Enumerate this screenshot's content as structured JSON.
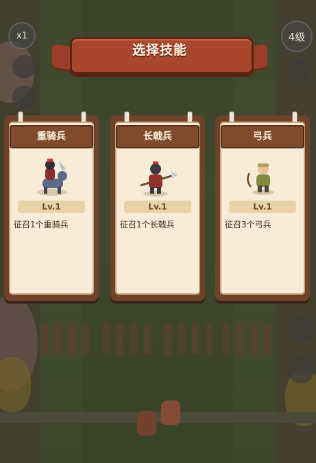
{
  "hud": {
    "speed_label": "x1",
    "level_label": "4级"
  },
  "banner": {
    "title": "选择技能"
  },
  "cards": [
    {
      "name": "重骑兵",
      "level": "Lv.1",
      "description": "征召1个重骑兵",
      "icon": "heavy-cavalry-icon"
    },
    {
      "name": "长戟兵",
      "level": "Lv.1",
      "description": "征召1个长戟兵",
      "icon": "halberdier-icon"
    },
    {
      "name": "弓兵",
      "level": "Lv.1",
      "description": "征召3个弓兵",
      "icon": "archer-icon"
    }
  ]
}
